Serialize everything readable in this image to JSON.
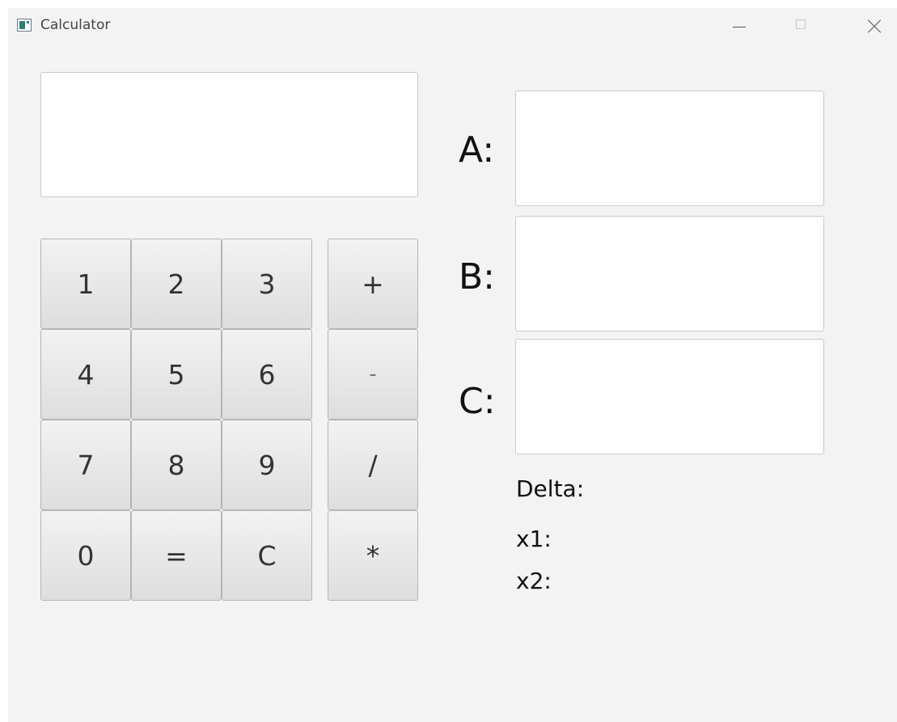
{
  "window": {
    "title": "Calculator"
  },
  "display": {
    "value": ""
  },
  "keypad": {
    "digits": [
      "1",
      "2",
      "3",
      "4",
      "5",
      "6",
      "7",
      "8",
      "9",
      "0",
      "=",
      "C"
    ],
    "operators": [
      "+",
      "-",
      "/",
      "*"
    ]
  },
  "quadratic": {
    "a_label": "A:",
    "b_label": "B:",
    "c_label": "C:",
    "a_value": "",
    "b_value": "",
    "c_value": "",
    "delta_label": "Delta:",
    "x1_label": "x1:",
    "x2_label": "x2:"
  }
}
